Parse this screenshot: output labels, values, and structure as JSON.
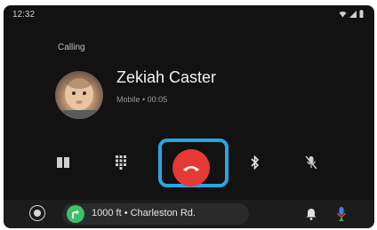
{
  "status_bar": {
    "time": "12:32"
  },
  "call": {
    "status": "Calling",
    "caller_name": "Zekiah Caster",
    "caller_detail": "Mobile • 00:05"
  },
  "controls": {
    "items": [
      {
        "name": "contacts-icon"
      },
      {
        "name": "dialpad-icon"
      },
      {
        "name": "end-call-icon"
      },
      {
        "name": "bluetooth-icon"
      },
      {
        "name": "mute-mic-icon"
      }
    ]
  },
  "navigation": {
    "instruction": "1000 ft • Charleston Rd."
  },
  "colors": {
    "end_call": "#e53935",
    "highlight": "#2aa6e0",
    "nav_turn": "#3ec16b",
    "mic": "#4a7bd8"
  }
}
